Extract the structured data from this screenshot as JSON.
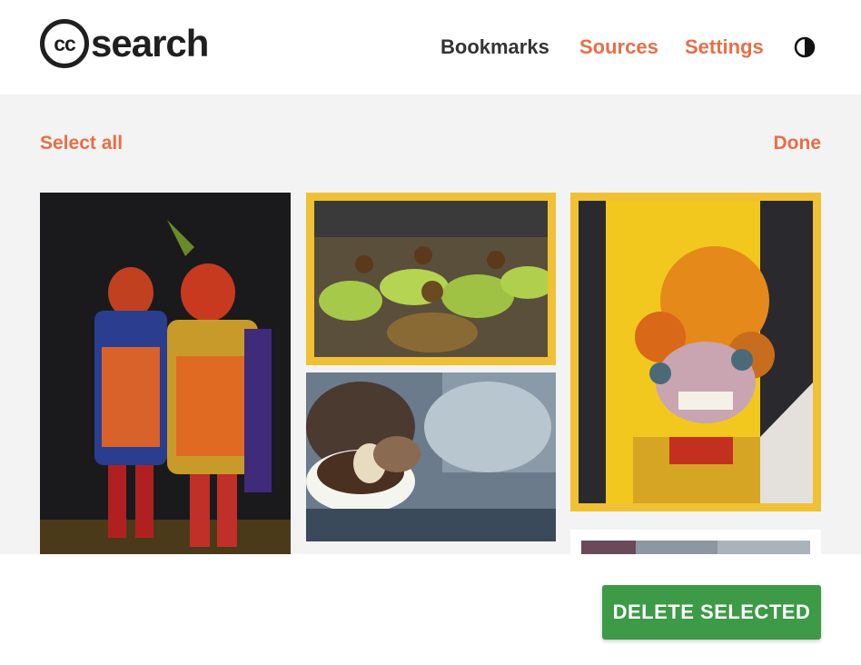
{
  "logo": {
    "cc": "cc",
    "word": "search"
  },
  "nav": {
    "bookmarks": "Bookmarks",
    "sources": "Sources",
    "settings": "Settings"
  },
  "toolbar": {
    "select_all": "Select all",
    "done": "Done"
  },
  "images": [
    {
      "description": "two masked carnival dancers in ornate costumes",
      "selected": false
    },
    {
      "description": "dancers in bowler hats and green skirts at parade",
      "selected": true
    },
    {
      "description": "hands holding a bowl of food",
      "selected": false
    },
    {
      "description": "close-up of golden diablada mask",
      "selected": true
    },
    {
      "description": "partially visible street scene",
      "selected": false
    }
  ],
  "footer": {
    "delete_label": "DELETE SELECTED"
  },
  "colors": {
    "accent": "#e76f47",
    "selected_border": "#f0c135",
    "delete_button": "#3d9a46",
    "text_dark": "#333333"
  }
}
